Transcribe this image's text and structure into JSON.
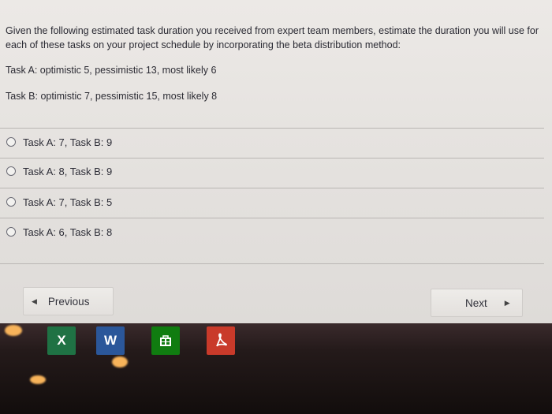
{
  "question": {
    "text": "Given the following estimated task duration you received from expert team members, estimate the duration you will use for each of these tasks on your project schedule by incorporating the beta distribution method:",
    "task_a": "Task A: optimistic 5, pessimistic 13, most likely 6",
    "task_b": "Task B: optimistic 7, pessimistic 15, most likely 8"
  },
  "options": [
    {
      "label": "Task A: 7, Task B: 9"
    },
    {
      "label": "Task A: 8, Task B: 9"
    },
    {
      "label": "Task A: 7, Task B: 5"
    },
    {
      "label": "Task A: 6, Task B: 8"
    }
  ],
  "nav": {
    "previous_label": "Previous",
    "next_label": "Next",
    "previous_arrow": "◀",
    "next_arrow": "▶"
  },
  "taskbar": {
    "icons": [
      {
        "name": "excel-icon",
        "letter": "X",
        "color": "#1f7244"
      },
      {
        "name": "word-icon",
        "letter": "W",
        "color": "#2b579a"
      },
      {
        "name": "store-icon",
        "letter": "",
        "color": "#107c10"
      },
      {
        "name": "acrobat-icon",
        "letter": "",
        "color": "#c93a2a"
      }
    ]
  }
}
